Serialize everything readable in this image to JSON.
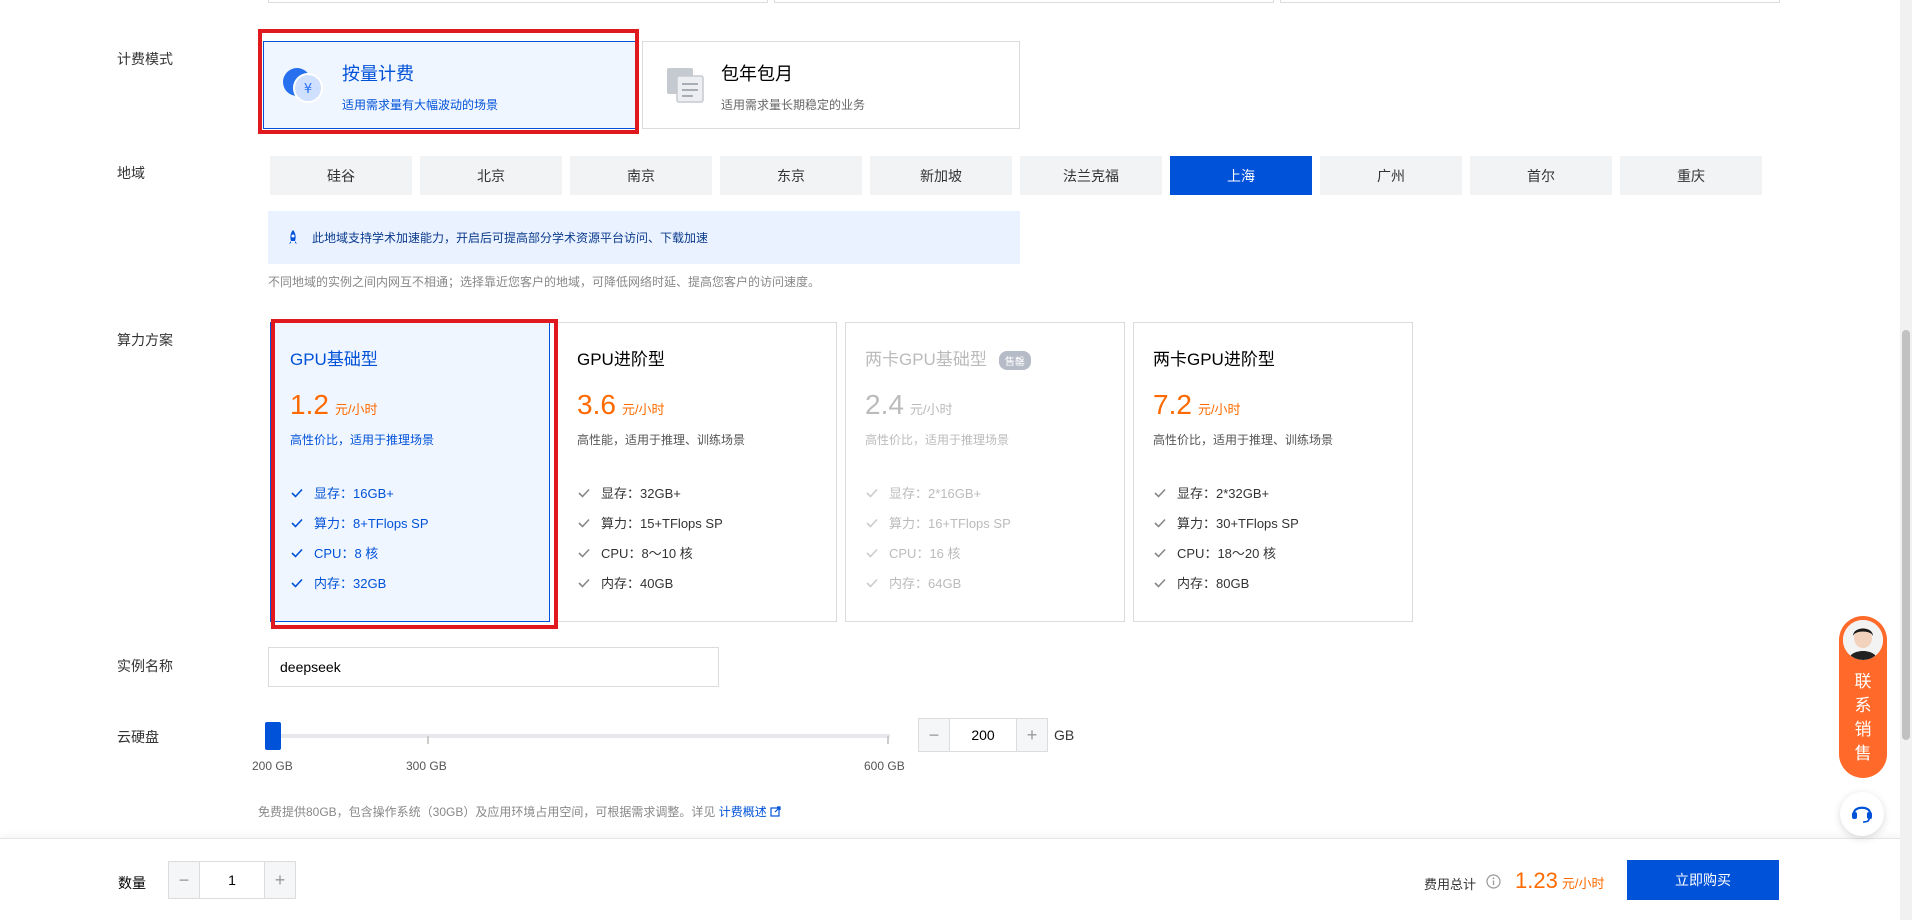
{
  "labels": {
    "billing_mode": "计费模式",
    "region": "地域",
    "compute_plan": "算力方案",
    "instance_name": "实例名称",
    "cloud_disk": "云硬盘",
    "quantity": "数量"
  },
  "billing": {
    "options": [
      {
        "title": "按量计费",
        "subtitle": "适用需求量有大幅波动的场景",
        "selected": true,
        "icon": "yuan-coin-icon"
      },
      {
        "title": "包年包月",
        "subtitle": "适用需求量长期稳定的业务",
        "selected": false,
        "icon": "calendar-icon"
      }
    ]
  },
  "regions": {
    "items": [
      "硅谷",
      "北京",
      "南京",
      "东京",
      "新加坡",
      "法兰克福",
      "上海",
      "广州",
      "首尔",
      "重庆"
    ],
    "selected": "上海",
    "tip": "此地域支持学术加速能力，开启后可提高部分学术资源平台访问、下载加速",
    "note": "不同地域的实例之间内网互不相通；选择靠近您客户的地域，可降低网络时延、提高您客户的访问速度。"
  },
  "plans": [
    {
      "name": "GPU基础型",
      "price": "1.2",
      "unit": "元/小时",
      "desc": "高性价比，适用于推理场景",
      "specs": [
        "显存：16GB+",
        "算力：8+TFlops SP",
        "CPU：8 核",
        "内存：32GB"
      ],
      "state": "selected"
    },
    {
      "name": "GPU进阶型",
      "price": "3.6",
      "unit": "元/小时",
      "desc": "高性能，适用于推理、训练场景",
      "specs": [
        "显存：32GB+",
        "算力：15+TFlops SP",
        "CPU：8～10 核",
        "内存：40GB"
      ],
      "state": "normal"
    },
    {
      "name": "两卡GPU基础型",
      "badge": "售罄",
      "price": "2.4",
      "unit": "元/小时",
      "desc": "高性价比，适用于推理场景",
      "specs": [
        "显存：2*16GB+",
        "算力：16+TFlops SP",
        "CPU：16 核",
        "内存：64GB"
      ],
      "state": "disabled"
    },
    {
      "name": "两卡GPU进阶型",
      "price": "7.2",
      "unit": "元/小时",
      "desc": "高性价比，适用于推理、训练场景",
      "specs": [
        "显存：2*32GB+",
        "算力：30+TFlops SP",
        "CPU：18～20 核",
        "内存：80GB"
      ],
      "state": "normal"
    }
  ],
  "instance": {
    "name_value": "deepseek"
  },
  "disk": {
    "min_label": "200 GB",
    "mid_label": "300 GB",
    "max_label": "600 GB",
    "value": "200",
    "unit": "GB",
    "minus": "−",
    "plus": "+",
    "note": "免费提供80GB，包含操作系统（30GB）及应用环境占用空间，可根据需求调整。详见",
    "link": "计费概述"
  },
  "footer": {
    "quantity_value": "1",
    "total_label": "费用总计",
    "total_price": "1.23",
    "total_unit": "元/小时",
    "buy_button": "立即购买"
  },
  "float": {
    "contact_text": "联系销售"
  },
  "colors": {
    "accent": "#0052d9",
    "price": "#ff6a00",
    "highlight": "#e0191f"
  }
}
